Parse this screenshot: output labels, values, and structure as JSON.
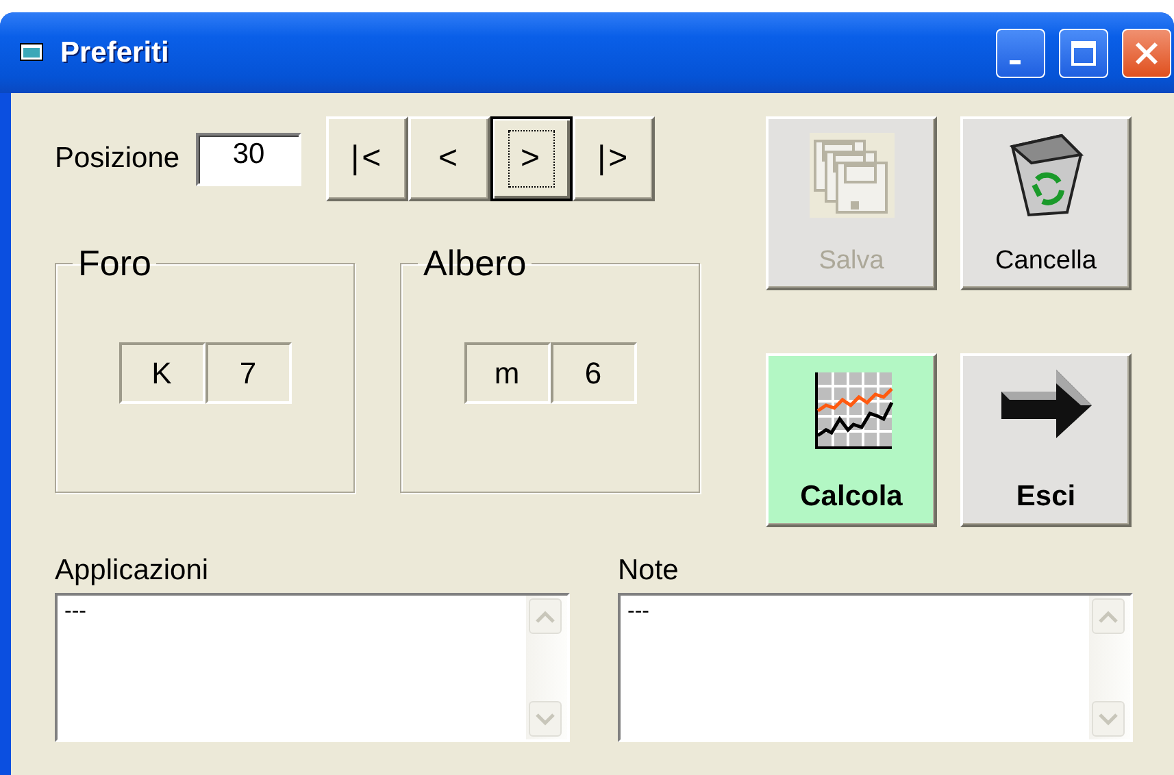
{
  "window": {
    "title": "Preferiti"
  },
  "position": {
    "label": "Posizione",
    "value": "30"
  },
  "navigation": [
    {
      "label": "|<",
      "focused": false
    },
    {
      "label": "<",
      "focused": false
    },
    {
      "label": ">",
      "focused": true
    },
    {
      "label": "|>",
      "focused": false
    }
  ],
  "actions": [
    {
      "label": "Salva",
      "disabled": true,
      "highlighted": false,
      "bold": false
    },
    {
      "label": "Cancella",
      "disabled": false,
      "highlighted": false,
      "bold": false
    },
    {
      "label": "Calcola",
      "disabled": false,
      "highlighted": true,
      "bold": true
    },
    {
      "label": "Esci",
      "disabled": false,
      "highlighted": false,
      "bold": true
    }
  ],
  "groups": [
    {
      "title": "Foro",
      "cells": [
        "K",
        "7"
      ]
    },
    {
      "title": "Albero",
      "cells": [
        "m",
        "6"
      ]
    }
  ],
  "memos": [
    {
      "label": "Applicazioni",
      "value": "---"
    },
    {
      "label": "Note",
      "value": "---"
    }
  ]
}
